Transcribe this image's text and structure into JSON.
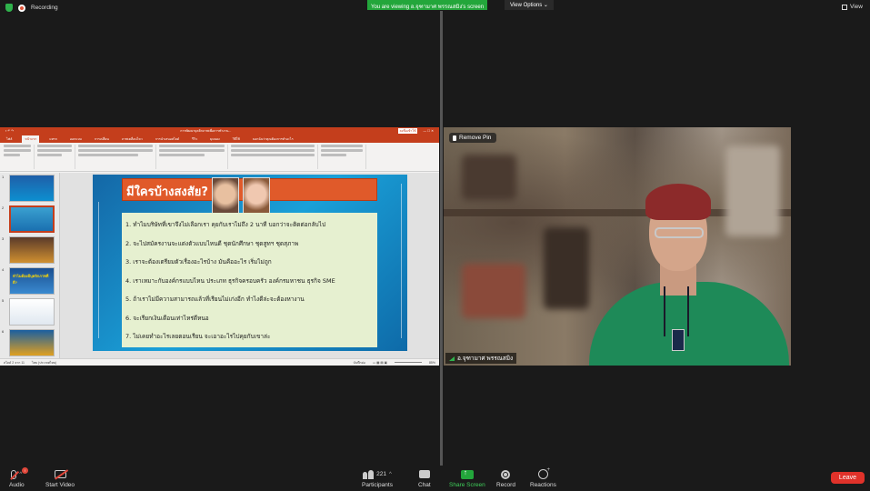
{
  "top": {
    "recording_label": "Recording",
    "viewing_banner": "You are viewing อ.จุฑามาศ พรรณสมิง's screen",
    "view_options_label": "View Options",
    "view_label": "View"
  },
  "ppt": {
    "doc_title": "การพัฒนาบุคลิกภาพเพื่อการทำงาน...",
    "signin_label": "ลงชื่อเข้าใช้",
    "tabs": [
      "ไฟล์",
      "หน้าแรก",
      "แทรก",
      "ออกแบบ",
      "การเปลี่ยน",
      "ภาพเคลื่อนไหว",
      "การนำเสนอสไลด์",
      "รีวิว",
      "มุมมอง",
      "วิธีใช้",
      "บอกฉันว่าคุณต้องการทำอะไร"
    ],
    "thumb_numbers": [
      "1",
      "2",
      "3",
      "4",
      "5",
      "6"
    ],
    "thumb4_text": "ทำไมต้องมีบุคลิกภาพที่ดี?",
    "slide": {
      "title": "มีใครบ้างสงสัย?",
      "items": [
        "1.  ทำไมบริษัทที่เขาจึงไม่เลือกเรา คุยกับเราไม่ถึง 2 นาที บอกว่าจะติดต่อกลับไป",
        "2.  จะไปสมัครงานจะแต่งตัวแบบไหนดี  ชุดนักศึกษา  ชุดสูทฯ  ชุดสุภาพ",
        "3.  เราจะต้องเตรียมตัวเรื่องอะไรบ้าง มันคืออะไร เริ่มไม่ถูก",
        "4.  เราเหมาะกับองค์กรแบบไหน  ประเภท ธุรกิจครอบครัว  องค์กรมหาชน  ธุรกิจ SME",
        "5.  ถ้าเราไม่มีความสามารถแล้วที่เรียนไม่เก่งอีก  ทำไงดีล่ะจะต้องหางาน",
        "6.  จะเรียกเงินเดือนเท่าไหร่ดีหนอ",
        "7.  ไม่เคยทำอะไรเลยตอนเรียน  จะเอาอะไรไปคุยกับเขาล่ะ"
      ]
    },
    "status_slide": "สไลด์ 2 จาก 11",
    "status_lang": "ไทย (ประเทศไทย)",
    "status_notes": "บันทึกย่อ",
    "status_zoom": "85%"
  },
  "video": {
    "remove_pin_label": "Remove Pin",
    "participant_name": "อ.จุฑามาศ พรรณสมิง"
  },
  "toolbar": {
    "audio_label": "Audio",
    "start_video_label": "Start Video",
    "participants_label": "Participants",
    "participants_count": "221",
    "chat_label": "Chat",
    "share_screen_label": "Share Screen",
    "record_label": "Record",
    "reactions_label": "Reactions",
    "leave_label": "Leave"
  },
  "colors": {
    "share_green": "#23a63b",
    "leave_red": "#e0322a",
    "ppt_accent": "#c43e1c"
  }
}
